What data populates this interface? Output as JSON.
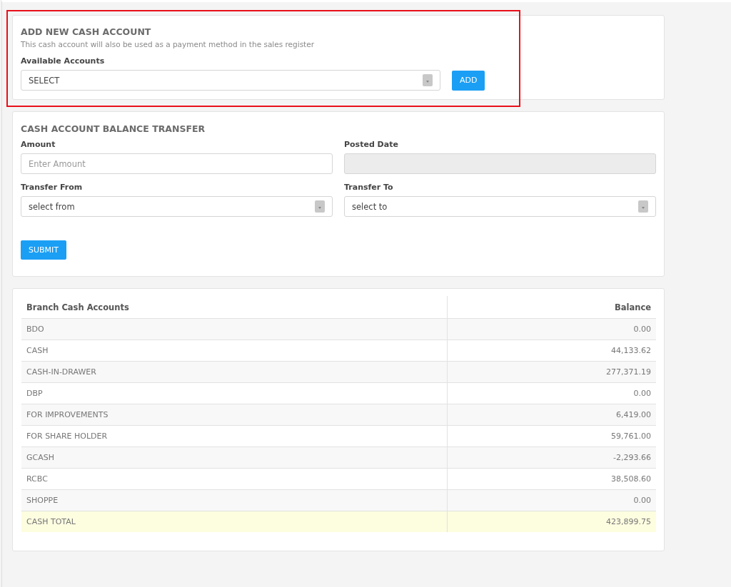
{
  "add_account": {
    "title": "ADD NEW CASH ACCOUNT",
    "highlighted": true,
    "description": "This cash account will also be used as a payment method in the sales register",
    "field_label": "Available Accounts",
    "select_value": "SELECT",
    "button": "ADD"
  },
  "transfer": {
    "title": "CASH ACCOUNT BALANCE TRANSFER",
    "fields": [
      {
        "kind": "input",
        "label": "Amount",
        "placeholder": "Enter Amount",
        "disabled": false
      },
      {
        "kind": "input",
        "label": "Posted Date",
        "disabled": true
      },
      {
        "kind": "select",
        "label": "Transfer From",
        "value": "select from"
      },
      {
        "kind": "select",
        "label": "Transfer To",
        "value": "select to"
      }
    ],
    "button": "SUBMIT"
  },
  "table": {
    "columns": [
      "Branch Cash Accounts",
      "Balance"
    ],
    "rows": [
      {
        "account": "BDO",
        "balance": "0.00",
        "total": false
      },
      {
        "account": "CASH",
        "balance": "44,133.62",
        "total": false
      },
      {
        "account": "CASH-IN-DRAWER",
        "balance": "277,371.19",
        "total": false
      },
      {
        "account": "DBP",
        "balance": "0.00",
        "total": false
      },
      {
        "account": "FOR IMPROVEMENTS",
        "balance": "6,419.00",
        "total": false
      },
      {
        "account": "FOR SHARE HOLDER",
        "balance": "59,761.00",
        "total": false
      },
      {
        "account": "GCASH",
        "balance": "-2,293.66",
        "total": false
      },
      {
        "account": "RCBC",
        "balance": "38,508.60",
        "total": false
      },
      {
        "account": "SHOPPE",
        "balance": "0.00",
        "total": false
      },
      {
        "account": "CASH TOTAL",
        "balance": "423,899.75",
        "total": true
      }
    ]
  }
}
